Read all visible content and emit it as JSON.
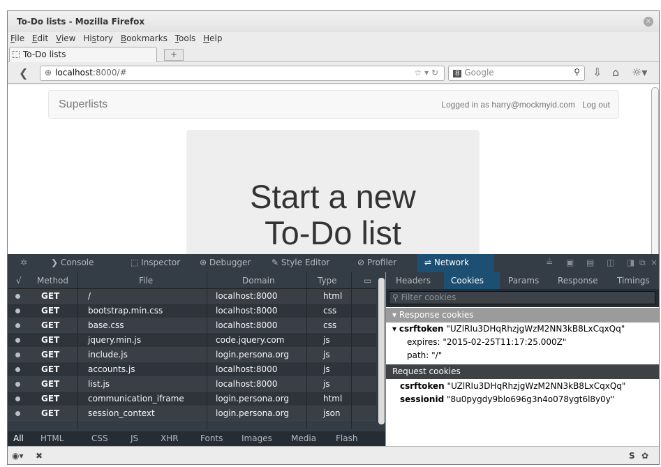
{
  "window": {
    "title": "To-Do lists - Mozilla Firefox",
    "close_icon": "close-icon"
  },
  "menu": [
    "File",
    "Edit",
    "View",
    "History",
    "Bookmarks",
    "Tools",
    "Help"
  ],
  "tab": {
    "label": "To-Do lists",
    "new_tab": "+"
  },
  "nav": {
    "url_host": "localhost",
    "url_rest": ":8000/#",
    "search_engine": "8",
    "search_placeholder": "Google"
  },
  "site": {
    "brand": "Superlists",
    "logged_in": "Logged in as harry@mockmyid.com",
    "logout": "Log out",
    "heading_line1": "Start a new",
    "heading_line2": "To-Do list"
  },
  "devtools": {
    "tools": [
      "Console",
      "Inspector",
      "Debugger",
      "Style Editor",
      "Profiler",
      "Network"
    ],
    "columns": {
      "check": "√",
      "method": "Method",
      "file": "File",
      "domain": "Domain",
      "type": "Type"
    },
    "requests": [
      {
        "method": "GET",
        "file": "/",
        "domain": "localhost:8000",
        "type": "html"
      },
      {
        "method": "GET",
        "file": "bootstrap.min.css",
        "domain": "localhost:8000",
        "type": "css"
      },
      {
        "method": "GET",
        "file": "base.css",
        "domain": "localhost:8000",
        "type": "css"
      },
      {
        "method": "GET",
        "file": "jquery.min.js",
        "domain": "code.jquery.com",
        "type": "js"
      },
      {
        "method": "GET",
        "file": "include.js",
        "domain": "login.persona.org",
        "type": "js"
      },
      {
        "method": "GET",
        "file": "accounts.js",
        "domain": "localhost:8000",
        "type": "js"
      },
      {
        "method": "GET",
        "file": "list.js",
        "domain": "localhost:8000",
        "type": "js"
      },
      {
        "method": "GET",
        "file": "communication_iframe",
        "domain": "login.persona.org",
        "type": "html"
      },
      {
        "method": "GET",
        "file": "session_context",
        "domain": "login.persona.org",
        "type": "json"
      }
    ],
    "filters": [
      "All",
      "HTML",
      "CSS",
      "JS",
      "XHR",
      "Fonts",
      "Images",
      "Media",
      "Flash"
    ],
    "detail_tabs": [
      "Headers",
      "Cookies",
      "Params",
      "Response",
      "Timings"
    ],
    "filter_placeholder": "Filter cookies",
    "response_header": "Response cookies",
    "csrf_name": "csrftoken",
    "csrf_value": "\"UZlRIu3DHqRhzjgWzM2NN3kB8LxCqxQq\"",
    "expires_label": "expires:",
    "expires_value": "\"2015-02-25T11:17:25.000Z\"",
    "path_label": "path:",
    "path_value": "\"/\"",
    "request_header": "Request cookies",
    "req_csrf_value": "\"UZlRIu3DHqRhzjgWzM2NN3kB8LxCqxQq\"",
    "session_name": "sessionid",
    "session_value": "\"8u0pygdy9blo696g3n4o078ygt6l8y0y\""
  },
  "colors": {
    "devtools_bg": "#343c45",
    "active_tab": "#1d4f73",
    "selected_row": "#9b9b9b"
  }
}
